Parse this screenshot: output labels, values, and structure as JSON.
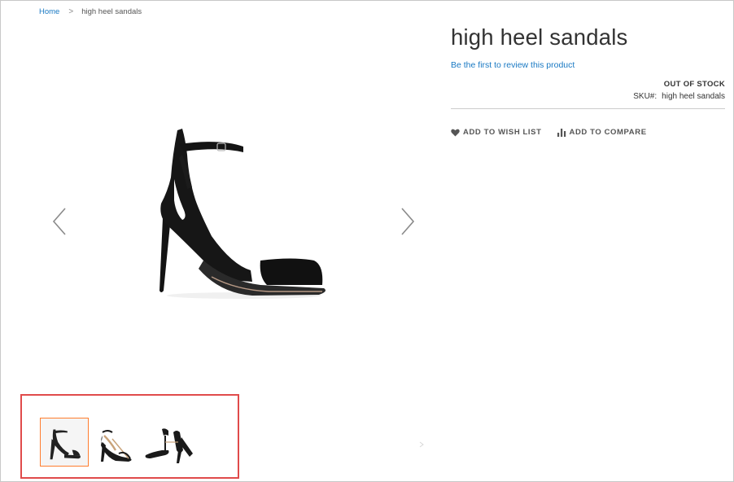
{
  "breadcrumb": {
    "home": "Home",
    "separator": ">",
    "current": "high heel sandals"
  },
  "product": {
    "title": "high heel sandals",
    "review_link": "Be the first to review this product",
    "stock_status": "OUT OF STOCK",
    "sku_label": "SKU#:",
    "sku_value": "high heel sandals"
  },
  "actions": {
    "wishlist": "ADD TO WISH LIST",
    "compare": "ADD TO COMPARE"
  },
  "gallery": {
    "icons": {
      "prev": "chevron-left-icon",
      "next": "chevron-right-icon"
    },
    "thumbnails": [
      {
        "name": "thumbnail-1",
        "selected": true
      },
      {
        "name": "thumbnail-2",
        "selected": false
      },
      {
        "name": "thumbnail-3",
        "selected": false
      }
    ]
  },
  "colors": {
    "link": "#1979c3",
    "thumbnail_selected_border": "#ff7d2e",
    "highlight_box": "#e04b4b",
    "text": "#333333"
  }
}
